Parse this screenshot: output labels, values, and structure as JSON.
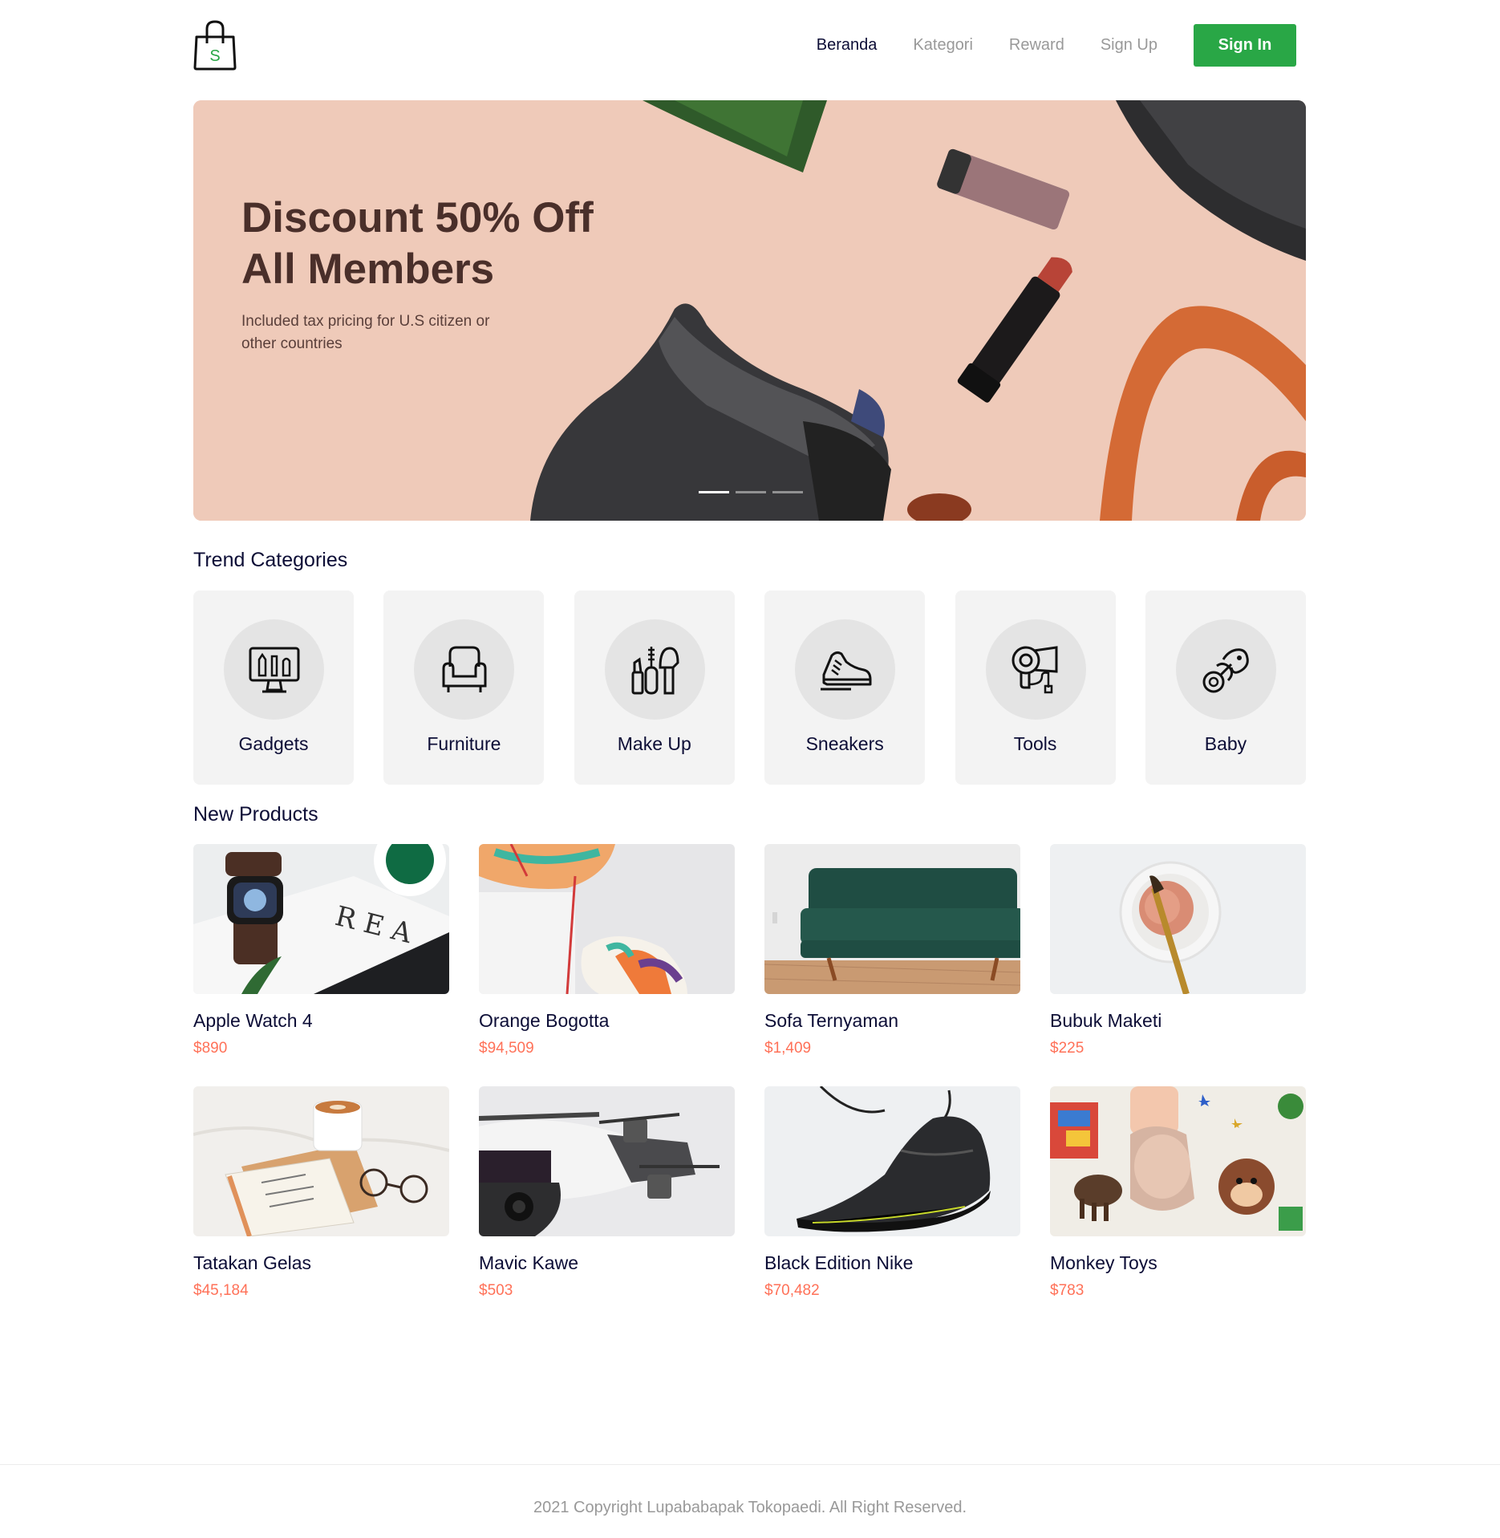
{
  "header": {
    "logo_letter": "S",
    "nav": {
      "home": "Beranda",
      "category": "Kategori",
      "reward": "Reward",
      "signup": "Sign Up",
      "signin": "Sign In"
    }
  },
  "banner": {
    "title_line1": "Discount 50% Off",
    "title_line2": "All Members",
    "subtitle_line1": "Included tax pricing for U.S citizen or",
    "subtitle_line2": "other countries",
    "slide_count": 3,
    "active_slide": 1
  },
  "categories": {
    "title": "Trend Categories",
    "items": [
      {
        "label": "Gadgets",
        "icon": "gadgets-icon"
      },
      {
        "label": "Furniture",
        "icon": "armchair-icon"
      },
      {
        "label": "Make Up",
        "icon": "makeup-icon"
      },
      {
        "label": "Sneakers",
        "icon": "sneaker-icon"
      },
      {
        "label": "Tools",
        "icon": "hair-dryer-icon"
      },
      {
        "label": "Baby",
        "icon": "pacifier-icon"
      }
    ]
  },
  "products": {
    "title": "New Products",
    "items": [
      {
        "name": "Apple Watch 4",
        "price": "$890"
      },
      {
        "name": "Orange Bogotta",
        "price": "$94,509"
      },
      {
        "name": "Sofa Ternyaman",
        "price": "$1,409"
      },
      {
        "name": "Bubuk Maketi",
        "price": "$225"
      },
      {
        "name": "Tatakan Gelas",
        "price": "$45,184"
      },
      {
        "name": "Mavic Kawe",
        "price": "$503"
      },
      {
        "name": "Black Edition Nike",
        "price": "$70,482"
      },
      {
        "name": "Monkey Toys",
        "price": "$783"
      }
    ]
  },
  "footer": {
    "copyright": "2021 Copyright Lupababapak Tokopaedi. All Right Reserved."
  },
  "colors": {
    "primary": "#29a746",
    "price": "#ff7158",
    "text": "#0c0d36",
    "muted": "#999999"
  }
}
